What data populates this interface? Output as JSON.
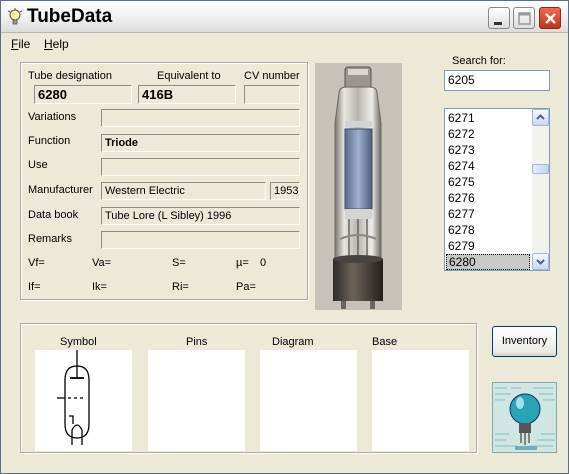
{
  "app": {
    "title": "TubeData"
  },
  "menu": {
    "file_letter": "F",
    "file_rest": "ile",
    "help_letter": "H",
    "help_rest": "elp"
  },
  "info": {
    "tube_designation_label": "Tube designation",
    "equivalent_label": "Equivalent to",
    "cv_label": "CV number",
    "tube_designation": "6280",
    "equivalent": "416B",
    "cv_number": "",
    "variations_label": "Variations",
    "variations": "",
    "function_label": "Function",
    "function": "Triode",
    "use_label": "Use",
    "use": "",
    "manufacturer_label": "Manufacturer",
    "manufacturer": "Western Electric",
    "year": "1953",
    "databook_label": "Data book",
    "databook": "Tube Lore (L Sibley) 1996",
    "remarks_label": "Remarks",
    "remarks": ""
  },
  "params": {
    "vf": "Vf=",
    "va": "Va=",
    "s": "S=",
    "mu": "µ=",
    "mu_value": "0",
    "if": "If=",
    "ik": "Ik=",
    "ri": "Ri=",
    "pa": "Pa="
  },
  "search": {
    "label": "Search for:",
    "value": "6205",
    "items": [
      "6271",
      "6272",
      "6273",
      "6274",
      "6275",
      "6276",
      "6277",
      "6278",
      "6279",
      "6280"
    ],
    "selected": "6280"
  },
  "panels": {
    "symbol": "Symbol",
    "pins": "Pins",
    "diagram": "Diagram",
    "base": "Base"
  },
  "buttons": {
    "inventory": "Inventory"
  }
}
